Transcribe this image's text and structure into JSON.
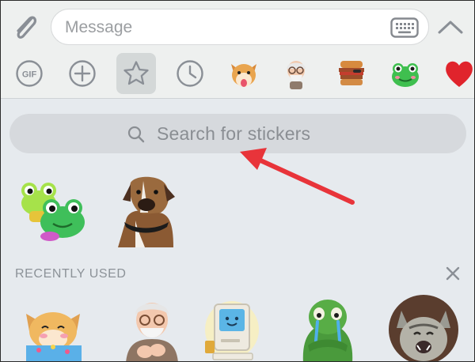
{
  "composer": {
    "placeholder": "Message",
    "attach_icon": "paperclip-icon",
    "keyboard_icon": "keyboard-icon",
    "collapse_icon": "chevron-up-icon"
  },
  "tabs": [
    {
      "name": "gif",
      "label": "GIF"
    },
    {
      "name": "add",
      "icon": "plus-circle-icon"
    },
    {
      "name": "favorites",
      "icon": "star-icon",
      "selected": true
    },
    {
      "name": "recent",
      "icon": "clock-icon"
    },
    {
      "name": "pack-shiba",
      "icon": "shiba-sticker-icon"
    },
    {
      "name": "pack-grandpa",
      "icon": "old-man-sticker-icon"
    },
    {
      "name": "pack-burger",
      "icon": "burger-sticker-icon"
    },
    {
      "name": "pack-frog",
      "icon": "frog-sticker-icon"
    },
    {
      "name": "pack-heart",
      "icon": "heart-icon"
    }
  ],
  "search": {
    "placeholder": "Search for stickers"
  },
  "favorites": [
    {
      "name": "frogs-sticker"
    },
    {
      "name": "boxer-dog-sticker"
    }
  ],
  "recently_used": {
    "title": "RECENTLY USED",
    "stickers": [
      {
        "name": "shiba-gift-sticker"
      },
      {
        "name": "old-man-clapping-sticker"
      },
      {
        "name": "computer-sticker"
      },
      {
        "name": "crying-frog-sticker"
      },
      {
        "name": "cat-sticker"
      }
    ]
  },
  "colors": {
    "accent_arrow": "#e8343a",
    "frog_green": "#3fbf4f",
    "heart_red": "#e0242c"
  }
}
